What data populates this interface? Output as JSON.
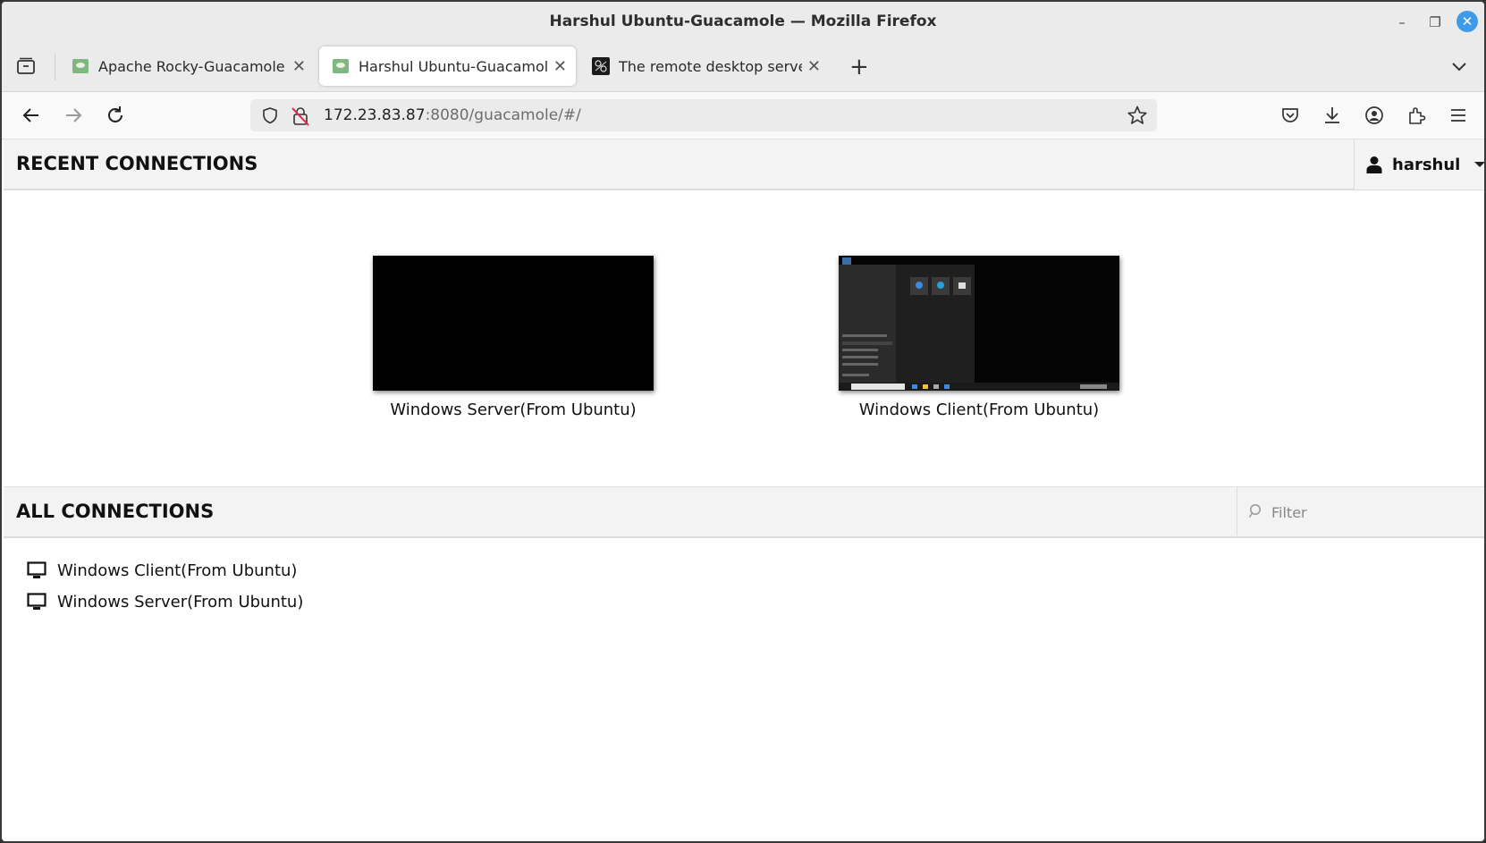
{
  "window": {
    "title": "Harshul Ubuntu-Guacamole — Mozilla Firefox",
    "controls": {
      "minimize": "–",
      "maximize": "❐",
      "close": "✕"
    }
  },
  "tabs": [
    {
      "label": "Apache Rocky-Guacamole",
      "active": false,
      "icon": "guacamole-favicon"
    },
    {
      "label": "Harshul Ubuntu-Guacamole",
      "active": true,
      "icon": "guacamole-favicon"
    },
    {
      "label": "The remote desktop server",
      "active": false,
      "icon": "remote-desktop-favicon"
    }
  ],
  "tab_close_glyph": "✕",
  "new_tab_glyph": "+",
  "url": {
    "host": "172.23.83.87",
    "rest": ":8080/guacamole/#/"
  },
  "recent": {
    "heading": "RECENT CONNECTIONS",
    "items": [
      {
        "label": "Windows Server(From Ubuntu)",
        "preview": "black-screen"
      },
      {
        "label": "Windows Client(From Ubuntu)",
        "preview": "windows-desktop-start-menu"
      }
    ]
  },
  "user": {
    "name": "harshul"
  },
  "all": {
    "heading": "ALL CONNECTIONS",
    "filter_placeholder": "Filter",
    "items": [
      {
        "label": "Windows Client(From Ubuntu)",
        "icon": "monitor-icon"
      },
      {
        "label": "Windows Server(From Ubuntu)",
        "icon": "monitor-icon"
      }
    ]
  },
  "colors": {
    "accent_close": "#3d9be9",
    "section_bg": "#f3f3f3",
    "favicon_green": "#7fb77e"
  }
}
